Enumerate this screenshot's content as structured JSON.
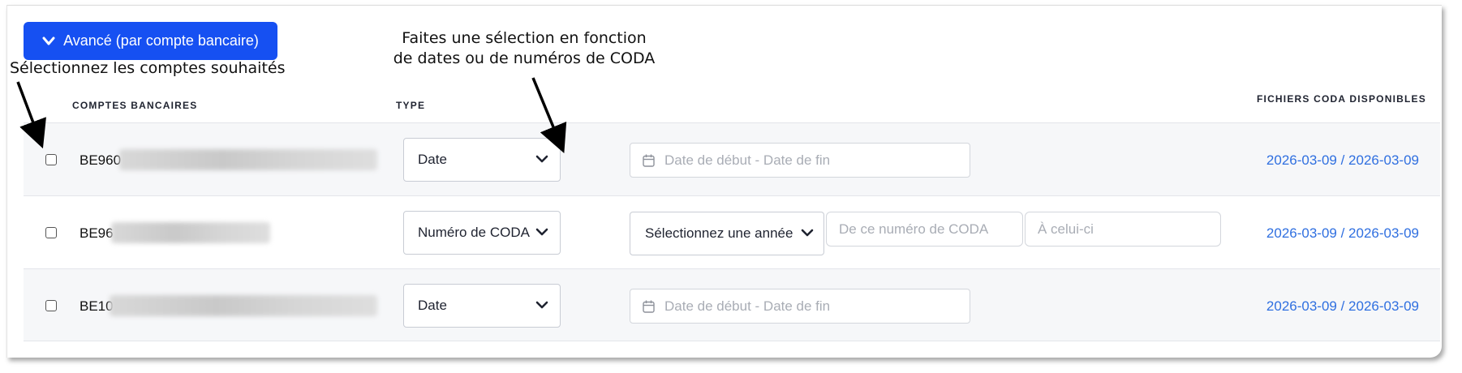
{
  "advanced_button": {
    "label": "Avancé (par compte bancaire)",
    "icon": "chevron-down-icon"
  },
  "annotations": {
    "select_accounts": "Sélectionnez les comptes souhaités",
    "select_by_line1": "Faites une sélection en fonction",
    "select_by_line2": "de dates ou de numéros de CODA"
  },
  "columns": {
    "bank_accounts": "COMPTES BANCAIRES",
    "type": "TYPE",
    "coda_files": "FICHIERS CODA DISPONIBLES"
  },
  "rows": [
    {
      "account": "BE960",
      "type": "Date",
      "date_placeholder": "Date de début - Date de fin",
      "coda_range": "2026-03-09 / 2026-03-09"
    },
    {
      "account": "BE96",
      "type": "Numéro de CODA",
      "year_placeholder": "Sélectionnez une année",
      "from_placeholder": "De ce numéro de CODA",
      "to_placeholder": "À celui-ci",
      "coda_range": "2026-03-09 / 2026-03-09"
    },
    {
      "account": "BE10",
      "type": "Date",
      "date_placeholder": "Date de début - Date de fin",
      "coda_range": "2026-03-09 / 2026-03-09"
    }
  ],
  "colors": {
    "primary": "#1650f2",
    "link": "#2f6fe0",
    "placeholder": "#a9adb5"
  }
}
